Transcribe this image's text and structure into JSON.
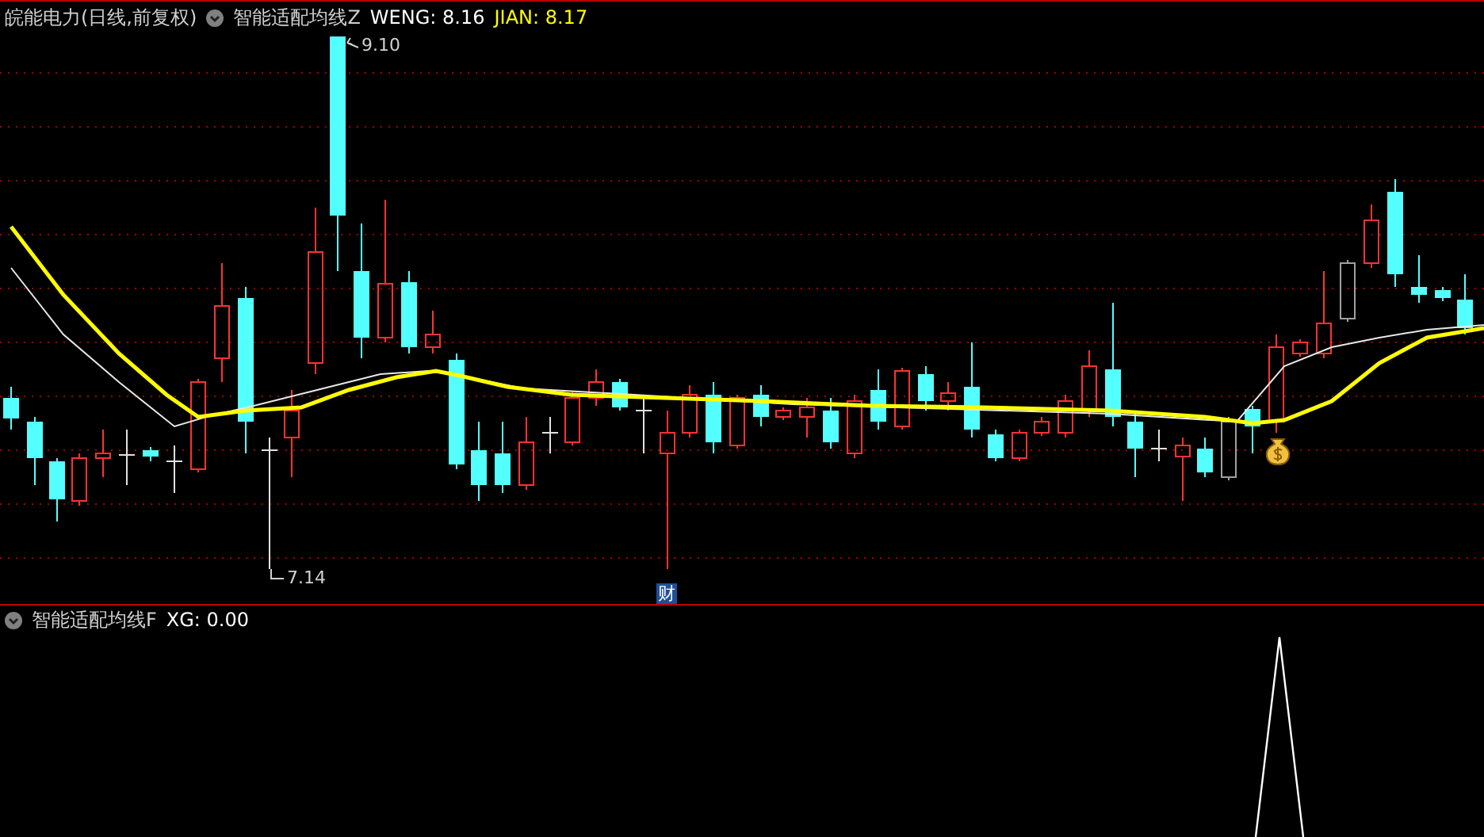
{
  "main_panel": {
    "stock_title": "皖能电力(日线,前复权)",
    "indicator": "智能适配均线Z",
    "values": [
      {
        "label": "WENG: 8.16",
        "color": "#ffffff"
      },
      {
        "label": "JIAN: 8.17",
        "color": "#ffff00"
      }
    ],
    "high_label": "9.10",
    "low_label": "7.14",
    "event_badge": "财"
  },
  "lower_panel": {
    "indicator": "智能适配均线F",
    "values": [
      {
        "label": "XG: 0.00",
        "color": "#ffffff"
      }
    ]
  }
}
